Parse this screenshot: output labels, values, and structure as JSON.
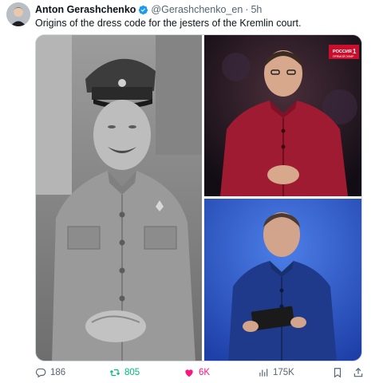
{
  "tweet": {
    "display_name": "Anton Gerashchenko",
    "handle": "@Gerashchenko_en",
    "separator": "·",
    "time": "5h",
    "text": "Origins of the dress code for the jesters of the Kremlin court.",
    "verified": true
  },
  "media": {
    "broadcast_logo": "РОССИЯ",
    "broadcast_logo_num": "1",
    "broadcast_logo_sub": "ПРЯМОЙ ЭФИР"
  },
  "actions": {
    "replies": "186",
    "retweets": "805",
    "likes": "6K",
    "views": "175K"
  },
  "colors": {
    "accent_blue": "#1d9bf0",
    "retweet_green": "#00ba7c",
    "like_pink": "#f91880",
    "muted": "#536471"
  },
  "icons": [
    "verified-badge-icon",
    "reply-icon",
    "retweet-icon",
    "heart-icon",
    "views-icon",
    "bookmark-icon",
    "share-icon"
  ]
}
